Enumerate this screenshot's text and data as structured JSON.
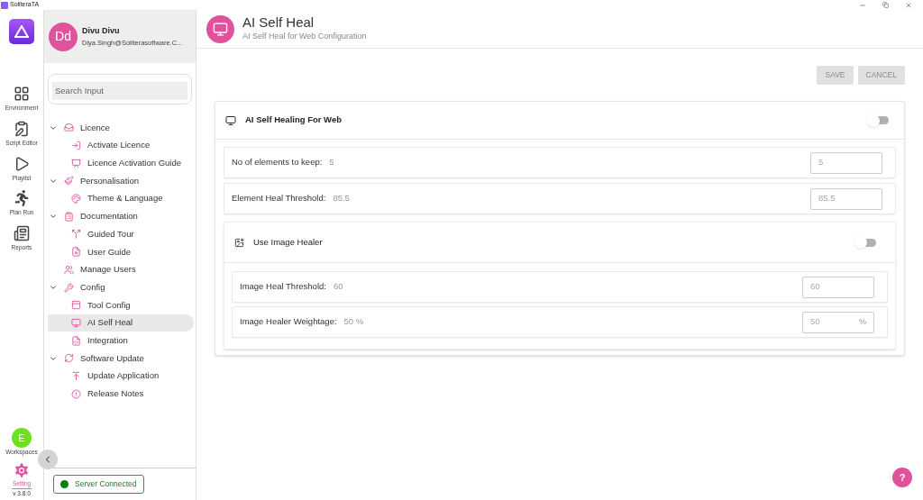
{
  "window": {
    "title": "SoliteraTA"
  },
  "rail": {
    "items": [
      {
        "label": "Environment",
        "selected": false
      },
      {
        "label": "Script Editor",
        "selected": false
      },
      {
        "label": "Playlist",
        "selected": false
      },
      {
        "label": "Plan Run",
        "selected": false
      },
      {
        "label": "Reports",
        "selected": false
      }
    ],
    "workspace": {
      "initial": "E",
      "label": "Workspaces"
    },
    "settings": {
      "label": "Setting",
      "selected": true
    },
    "version": "v 3.8.0"
  },
  "user": {
    "initials": "Dd",
    "name": "Divu Divu",
    "email": "Diya.Singh@Soliterasoftware.C..."
  },
  "search": {
    "placeholder": "Search Input"
  },
  "tree": [
    {
      "label": "Licence",
      "expanded": true,
      "selected": false,
      "children": [
        {
          "label": "Activate Licence",
          "selected": false
        },
        {
          "label": "Licence Activation Guide",
          "selected": false
        }
      ]
    },
    {
      "label": "Personalisation",
      "expanded": true,
      "selected": false,
      "children": [
        {
          "label": "Theme & Language",
          "selected": false
        }
      ]
    },
    {
      "label": "Documentation",
      "expanded": true,
      "selected": false,
      "children": [
        {
          "label": "Guided Tour",
          "selected": false
        },
        {
          "label": "User Guide",
          "selected": false
        }
      ]
    },
    {
      "label": "Manage Users",
      "selected": false
    },
    {
      "label": "Config",
      "expanded": true,
      "selected": false,
      "children": [
        {
          "label": "Tool Config",
          "selected": false
        },
        {
          "label": "AI Self Heal",
          "selected": true
        },
        {
          "label": "Integration",
          "selected": false
        }
      ]
    },
    {
      "label": "Software Update",
      "expanded": true,
      "selected": false,
      "children": [
        {
          "label": "Update Application",
          "selected": false
        },
        {
          "label": "Release Notes",
          "selected": false
        }
      ]
    }
  ],
  "status": {
    "label": "Server Connected",
    "connected": true
  },
  "header": {
    "title": "AI Self Heal",
    "subtitle": "AI Self Heal for Web Configuration"
  },
  "buttons": [
    {
      "label": "SAVE",
      "disabled": true
    },
    {
      "label": "CANCEL",
      "disabled": true
    }
  ],
  "section": {
    "title": "AI Self Healing For Web",
    "on": false,
    "fields": [
      {
        "label": "No of elements to keep:",
        "value": "5",
        "input": "5"
      },
      {
        "label": "Element Heal Threshold:",
        "value": "85.5",
        "input": "85.5"
      }
    ],
    "subsection": {
      "title": "Use Image Healer",
      "on": false,
      "fields": [
        {
          "label": "Image Heal Threshold:",
          "value": "60",
          "input": "60"
        },
        {
          "label": "Image Healer Weightage:",
          "value": "50 %",
          "input": "50",
          "unit": "%"
        }
      ]
    }
  },
  "help": {
    "label": "?"
  }
}
